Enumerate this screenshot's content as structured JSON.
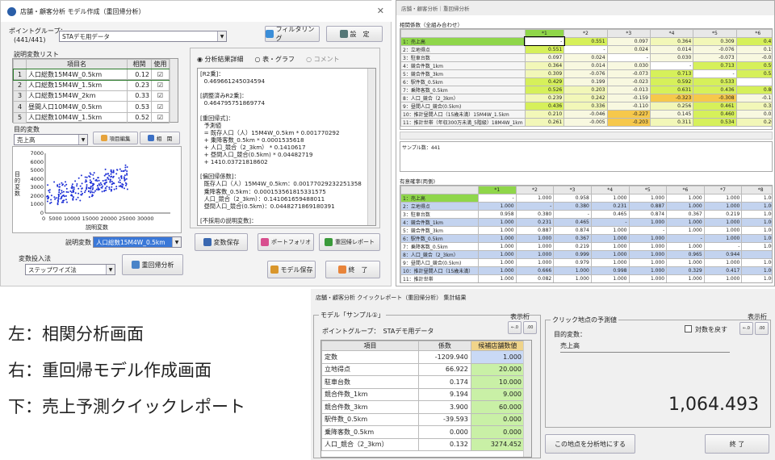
{
  "left": {
    "title": "店舗・顧客分析 モデル作成（重回帰分析）",
    "point_group_label": "ポイントグループ：",
    "point_group_count": "(441/441)",
    "point_group_value": "STAデモ用データ",
    "filter_btn": "フィルタリング",
    "settings_btn": "設　定",
    "var_list_label": "説明変数リスト",
    "columns": [
      "項目名",
      "相関",
      "使用"
    ],
    "rows": [
      {
        "no": "1",
        "name": "人口総数15M4W_0.5km",
        "corr": "0.12",
        "used": "☑"
      },
      {
        "no": "2",
        "name": "人口総数15M4W_1.5km",
        "corr": "0.23",
        "used": "☑"
      },
      {
        "no": "3",
        "name": "人口総数15M4W_2km",
        "corr": "0.33",
        "used": "☑"
      },
      {
        "no": "4",
        "name": "昼間人口10M4W_0.5km",
        "corr": "0.53",
        "used": "☑"
      },
      {
        "no": "5",
        "name": "人口総数10M4W_1.5km",
        "corr": "0.52",
        "used": "☑"
      }
    ],
    "target_label": "目的変数",
    "target_value": "売上高",
    "item_edit_btn": "項目編集",
    "correlation_btn": "相　関",
    "scatter": {
      "y_label": "目的変数",
      "x_label": "説明変数",
      "y_ticks": [
        "7000",
        "6000",
        "5000",
        "4000",
        "3000",
        "2000",
        "1000",
        "0"
      ],
      "x_ticks": "0  5000 10000 15000 20000 25000 30000"
    },
    "expl_label": "説明変数",
    "expl_value": "人口総数15M4W_0.5km",
    "method_label": "変数投入法",
    "method_value": "ステップワイズ法",
    "regression_btn": "重回帰分析",
    "radio_detail": "分析結果詳細",
    "radio_table": "表・グラフ",
    "radio_comment": "コメント",
    "result_lines": [
      "[R2乗]：",
      "  0.469661245034594",
      "",
      "[調整済みR2乗]：",
      "  0.464795751869774",
      "",
      "[重回帰式]：",
      "  予測値",
      "  = 既存人口（人）15M4W_0.5km * 0.001770292",
      "  + 乗降客数_0.5km * 0.0001535618",
      "  + 人口_競合（2_3km） * 0.1410617",
      "  + 昼間人口_競合(0.5km) * 0.04482719",
      "  + 1410.03721818602",
      "",
      "[偏回帰係数]：",
      "  既存人口（人）15M4W_0.5km：0.00177029232251358",
      "  乗降客数_0.5km：0.000153561815331575",
      "  人口_競合（2_3km）：0.141061659488011",
      "  昼間人口_競合(0.5km)：0.0448271869180391",
      "",
      "[不採用の説明変数]："
    ],
    "save_var_btn": "変数保存",
    "portfolio_btn": "ポートフォリオ",
    "report_btn": "重回帰レポート",
    "model_save_btn": "モデル保存",
    "close_btn": "終　了"
  },
  "right": {
    "title": "店舗・顧客分析｜重回帰分析",
    "corr_label": "相関係数（全組み合わせ）",
    "cols": [
      "*1",
      "*2",
      "*3",
      "*4",
      "*5",
      "*6"
    ],
    "rows": [
      {
        "name": "1：売上高",
        "v": [
          "-",
          "0.551",
          "0.097",
          "0.364",
          "0.309",
          "0.429"
        ]
      },
      {
        "name": "2：立地得点",
        "v": [
          "0.551",
          "-",
          "0.024",
          "0.014",
          "-0.076",
          "0.199"
        ]
      },
      {
        "name": "3：駐車台数",
        "v": [
          "0.097",
          "0.024",
          "-",
          "0.030",
          "-0.073",
          "-0.023"
        ]
      },
      {
        "name": "4：競合件数_1km",
        "v": [
          "0.364",
          "0.014",
          "0.030",
          "-",
          "0.713",
          "0.592"
        ]
      },
      {
        "name": "5：競合件数_3km",
        "v": [
          "0.309",
          "-0.076",
          "-0.073",
          "0.713",
          "-",
          "0.533"
        ]
      },
      {
        "name": "6：駅件数_0.5km",
        "v": [
          "0.429",
          "0.199",
          "-0.023",
          "0.592",
          "0.533",
          "-"
        ]
      },
      {
        "name": "7：乗降客数_0.5km",
        "v": [
          "0.526",
          "0.203",
          "-0.013",
          "0.631",
          "0.436",
          "0.800"
        ]
      },
      {
        "name": "8：人口_競合（2_3km）",
        "v": [
          "0.239",
          "0.242",
          "-0.159",
          "-0.323",
          "-0.308",
          "-0.115"
        ]
      },
      {
        "name": "9：昼間人口_競合(0.5km)",
        "v": [
          "0.436",
          "0.336",
          "-0.110",
          "0.256",
          "0.461",
          "0.331"
        ]
      },
      {
        "name": "10：推計昼間人口（15歳未満）15M4W_1.5km",
        "v": [
          "0.210",
          "-0.046",
          "-0.227",
          "0.145",
          "0.460",
          "0.034"
        ]
      },
      {
        "name": "11：推計世帯（年収300万未満_5階級）18M4W_1km",
        "v": [
          "0.261",
          "-0.005",
          "-0.203",
          "0.311",
          "0.534",
          "0.203"
        ]
      }
    ],
    "sample_label": "サンプル数：441",
    "sig_label": "有意確率(両側)",
    "sig_cols": [
      "*1",
      "*2",
      "*3",
      "*4",
      "*5",
      "*6",
      "*7",
      "*8"
    ],
    "sig_rows": [
      {
        "name": "1：売上高",
        "v": [
          "-",
          "1.000",
          "0.958",
          "1.000",
          "1.000",
          "1.000",
          "1.000",
          "1.000"
        ]
      },
      {
        "name": "2：立地得点",
        "v": [
          "1.000",
          "-",
          "0.380",
          "0.231",
          "0.887",
          "1.000",
          "1.000",
          "1.000"
        ]
      },
      {
        "name": "3：駐車台数",
        "v": [
          "0.958",
          "0.380",
          "-",
          "0.465",
          "0.874",
          "0.367",
          "0.219",
          "1.000"
        ]
      },
      {
        "name": "4：競合件数_1km",
        "v": [
          "1.000",
          "0.231",
          "0.465",
          "-",
          "1.000",
          "1.000",
          "1.000",
          "1.000"
        ]
      },
      {
        "name": "5：競合件数_3km",
        "v": [
          "1.000",
          "0.887",
          "0.874",
          "1.000",
          "-",
          "1.000",
          "1.000",
          "1.000"
        ]
      },
      {
        "name": "6：駅件数_0.5km",
        "v": [
          "1.000",
          "1.000",
          "0.367",
          "1.000",
          "1.000",
          "-",
          "1.000",
          "1.000"
        ]
      },
      {
        "name": "7：乗降客数_0.5km",
        "v": [
          "1.000",
          "1.000",
          "0.219",
          "1.000",
          "1.000",
          "1.000",
          "-",
          "1.000"
        ]
      },
      {
        "name": "8：人口_競合（2_3km）",
        "v": [
          "1.000",
          "1.000",
          "0.999",
          "1.000",
          "1.000",
          "0.965",
          "0.944",
          "-"
        ]
      },
      {
        "name": "9：昼間人口_競合(0.5km)",
        "v": [
          "1.000",
          "1.000",
          "0.979",
          "1.000",
          "1.000",
          "1.000",
          "1.000",
          "1.000"
        ]
      },
      {
        "name": "10：推計昼間人口（15歳未満）",
        "v": [
          "1.000",
          "0.666",
          "1.000",
          "0.998",
          "1.000",
          "0.329",
          "0.417",
          "1.000"
        ]
      },
      {
        "name": "11：推計世帯",
        "v": [
          "1.000",
          "0.082",
          "1.000",
          "1.000",
          "1.000",
          "1.000",
          "1.000",
          "1.000"
        ]
      }
    ]
  },
  "captions": [
    "左：相関分析画面",
    "右：重回帰モデル作成画面",
    "下：売上予測クイックレポート"
  ],
  "bottom": {
    "title": "店舗・顧客分析 クイックレポート（重回帰分析） 集計結果",
    "model_frame": "モデル「サンプル①」",
    "display_digits": "表示桁",
    "point_group": "ポイントグループ：　STAデモ用データ",
    "cols": [
      "項目",
      "係数",
      "候補店舗数値"
    ],
    "rows": [
      {
        "item": "定数",
        "coef": "-1209.940",
        "val": "1.000"
      },
      {
        "item": "立地得点",
        "coef": "66.922",
        "val": "20.000"
      },
      {
        "item": "駐車台数",
        "coef": "0.174",
        "val": "10.000"
      },
      {
        "item": "競合件数_1km",
        "coef": "9.194",
        "val": "9.000"
      },
      {
        "item": "競合件数_3km",
        "coef": "3.900",
        "val": "60.000"
      },
      {
        "item": "駅件数_0.5km",
        "coef": "-39.593",
        "val": "0.000"
      },
      {
        "item": "乗降客数_0.5km",
        "coef": "0.000",
        "val": "0.000"
      },
      {
        "item": "人口_競合（2_3km）",
        "coef": "0.132",
        "val": "3274.452"
      }
    ],
    "pred_frame": "クリック地点の予測値",
    "target_label": "目的変数：",
    "target_value": "売上高",
    "log_label": "対数を戻す",
    "prediction": "1,064.493",
    "analyze_btn": "この地点を分析地にする",
    "close_btn": "終 了"
  }
}
